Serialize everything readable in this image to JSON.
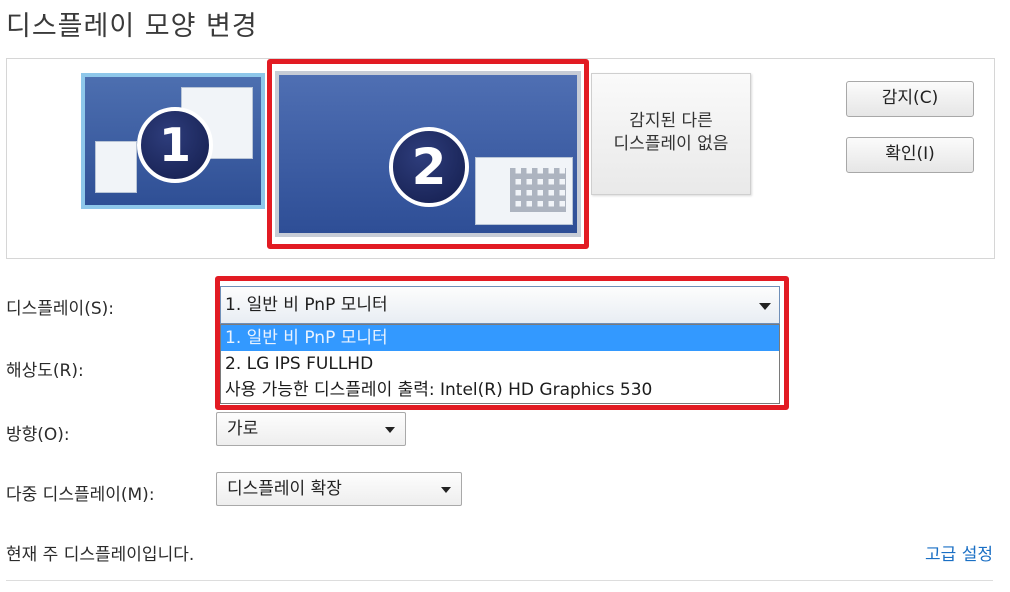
{
  "page": {
    "title": "디스플레이 모양 변경"
  },
  "preview": {
    "monitor1_number": "1",
    "monitor2_number": "2",
    "monitor3_text_line1": "감지된 다른",
    "monitor3_text_line2": "디스플레이 없음",
    "selected_monitor": "2"
  },
  "buttons": {
    "detect": "감지(C)",
    "identify": "확인(I)"
  },
  "form": {
    "display_label": "디스플레이(S):",
    "display_value": "1. 일반 비 PnP 모니터",
    "display_options": [
      "1. 일반 비 PnP 모니터",
      "2. LG IPS FULLHD",
      "사용 가능한 디스플레이 출력: Intel(R) HD Graphics 530"
    ],
    "display_options_selected_index": 0,
    "resolution_label": "해상도(R):",
    "orientation_label": "방향(O):",
    "orientation_value": "가로",
    "multi_label": "다중 디스플레이(M):",
    "multi_value": "디스플레이 확장"
  },
  "footer": {
    "status": "현재 주 디스플레이입니다.",
    "advanced_link": "고급 설정"
  },
  "colors": {
    "highlight_frame": "#e21b23",
    "selection": "#3399ff",
    "link": "#1a6fc4"
  }
}
